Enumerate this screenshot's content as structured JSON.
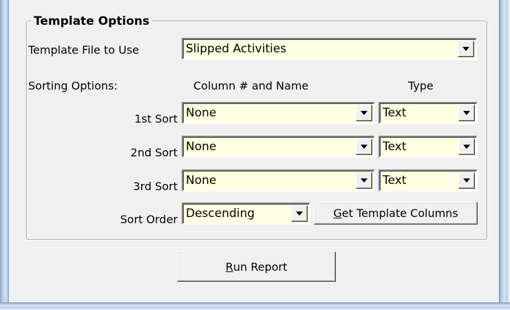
{
  "group": {
    "title": "Template Options"
  },
  "template_file": {
    "label": "Template File to Use",
    "value": "Slipped Activities"
  },
  "sorting": {
    "options_label": "Sorting Options:",
    "column_header": "Column # and Name",
    "type_header": "Type",
    "sorts": [
      {
        "label": "1st Sort",
        "column": "None",
        "type": "Text"
      },
      {
        "label": "2nd Sort",
        "column": "None",
        "type": "Text"
      },
      {
        "label": "3rd Sort",
        "column": "None",
        "type": "Text"
      }
    ],
    "order_label": "Sort Order",
    "order_value": "Descending"
  },
  "buttons": {
    "get_columns": {
      "mnemonic": "G",
      "rest": "et Template Columns"
    },
    "run_report": {
      "mnemonic": "R",
      "rest": "un Report"
    }
  },
  "icons": {
    "dropdown": "dropdown-arrow-icon"
  },
  "colors": {
    "input_bg": "#ffffe1",
    "dialog_bg": "#f0f0f0"
  }
}
